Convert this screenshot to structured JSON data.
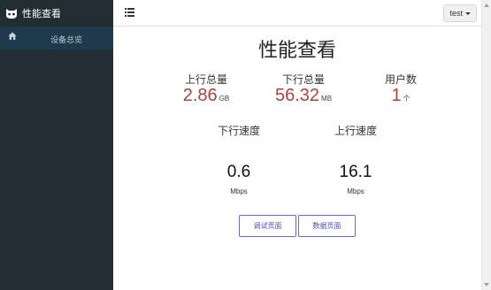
{
  "brand": {
    "title": "性能查看",
    "icon": "cat-logo-icon"
  },
  "sidebar": {
    "items": [
      {
        "label": "设备总览",
        "icon": "home-icon",
        "active": true
      }
    ]
  },
  "topbar": {
    "menu_icon": "list-icon",
    "user": "test"
  },
  "main": {
    "title": "性能查看",
    "stats": [
      {
        "label": "上行总量",
        "value": "2.86",
        "unit": "GB"
      },
      {
        "label": "下行总量",
        "value": "56.32",
        "unit": "MB"
      },
      {
        "label": "用户数",
        "value": "1",
        "unit": "个"
      }
    ],
    "speeds": [
      {
        "label": "下行速度",
        "value": "0.6",
        "unit": "Mbps"
      },
      {
        "label": "上行速度",
        "value": "16.1",
        "unit": "Mbps"
      }
    ],
    "buttons": {
      "debug": "调试页面",
      "data": "数据页面"
    }
  },
  "colors": {
    "sidebar_bg": "#222d32",
    "active_item_bg": "#1e3a4c",
    "stat_value": "#a94442",
    "button_border": "#6a6ad0"
  }
}
